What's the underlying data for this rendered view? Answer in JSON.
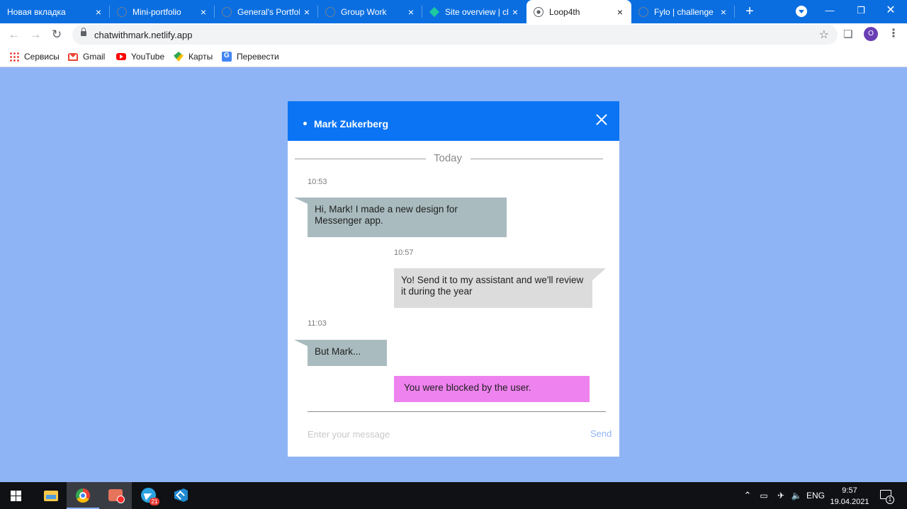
{
  "browser": {
    "tabs": [
      {
        "title": "Новая вкладка",
        "active": false
      },
      {
        "title": "Mini-portfolio",
        "active": false
      },
      {
        "title": "General's Portfolio",
        "active": false
      },
      {
        "title": "Group Work",
        "active": false
      },
      {
        "title": "Site overview | ch",
        "active": false
      },
      {
        "title": "Loop4th",
        "active": true
      },
      {
        "title": "Fylo | challenge",
        "active": false
      }
    ],
    "new_tab_label": "+",
    "close_glyph": "×",
    "url": "chatwithmark.netlify.app",
    "profile_initial": "O",
    "accent": "#0a6ee0",
    "bookmarks": [
      {
        "label": "Сервисы",
        "icon": "apps-icon"
      },
      {
        "label": "Gmail",
        "icon": "gmail-icon"
      },
      {
        "label": "YouTube",
        "icon": "youtube-icon"
      },
      {
        "label": "Карты",
        "icon": "maps-icon"
      },
      {
        "label": "Перевести",
        "icon": "translate-icon"
      }
    ]
  },
  "chat": {
    "contact_name": "Mark Zukerberg",
    "header_color": "#0a74f5",
    "page_background": "#8fb4f5",
    "day_label": "Today",
    "messages": [
      {
        "time": "10:53",
        "text": "Hi, Mark! I made a new design for Messenger app.",
        "direction": "incoming"
      },
      {
        "time": "10:57",
        "text": "Yo! Send it to my assistant and we'll review it during the year",
        "direction": "outgoing"
      },
      {
        "time": "11:03",
        "text": "But Mark...",
        "direction": "incoming"
      },
      {
        "time": "",
        "text": "You were blocked by the user.",
        "direction": "system",
        "color": "#ee82ee"
      }
    ],
    "input_placeholder": "Enter your message",
    "send_label": "Send"
  },
  "taskbar": {
    "apps": [
      "windows-start",
      "file-explorer",
      "chrome",
      "screen-recorder",
      "telegram",
      "vscode"
    ],
    "telegram_badge": "21",
    "language": "ENG",
    "time": "9:57",
    "date": "19.04.2021",
    "notification_count": "1"
  }
}
